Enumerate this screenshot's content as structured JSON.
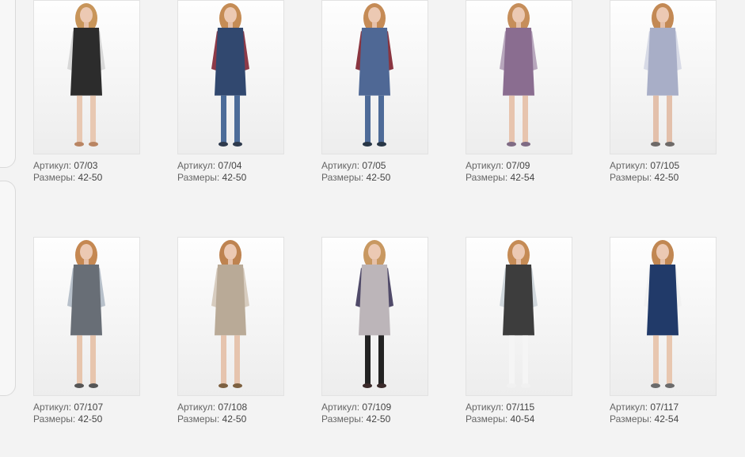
{
  "products": [
    {
      "article_label": "Артикул:",
      "article": "07/03",
      "sizes_label": "Размеры:",
      "sizes": "42-50",
      "dress": "#2c2c2c",
      "accent": "#d8d8d8",
      "hair": "#c8955a",
      "legs": "#e8c8b2",
      "shoes": "#b98563",
      "image_icon": "model-photo-icon"
    },
    {
      "article_label": "Артикул:",
      "article": "07/04",
      "sizes_label": "Размеры:",
      "sizes": "42-50",
      "dress": "#31486f",
      "accent": "#8d3a48",
      "hair": "#c58c55",
      "legs": "#4c6c99",
      "shoes": "#2e3a4d",
      "image_icon": "model-photo-icon"
    },
    {
      "article_label": "Артикул:",
      "article": "07/05",
      "sizes_label": "Размеры:",
      "sizes": "42-50",
      "dress": "#4f6895",
      "accent": "#8a3540",
      "hair": "#c58b56",
      "legs": "#4e6b98",
      "shoes": "#283646",
      "image_icon": "model-photo-icon"
    },
    {
      "article_label": "Артикул:",
      "article": "07/09",
      "sizes_label": "Размеры:",
      "sizes": "42-54",
      "dress": "#8a6d90",
      "accent": "#b7a6bc",
      "hair": "#c68e5a",
      "legs": "#e7c4ae",
      "shoes": "#7f6b84",
      "image_icon": "model-photo-icon"
    },
    {
      "article_label": "Артикул:",
      "article": "07/105",
      "sizes_label": "Размеры:",
      "sizes": "42-50",
      "dress": "#a8aec7",
      "accent": "#d7dae6",
      "hair": "#c38954",
      "legs": "#e3c0ab",
      "shoes": "#6e6a68",
      "image_icon": "model-photo-icon"
    },
    {
      "article_label": "Артикул:",
      "article": "07/107",
      "sizes_label": "Размеры:",
      "sizes": "42-50",
      "dress": "#686e76",
      "accent": "#b7c0ca",
      "hair": "#c58852",
      "legs": "#e7c5ad",
      "shoes": "#555",
      "image_icon": "model-photo-icon"
    },
    {
      "article_label": "Артикул:",
      "article": "07/108",
      "sizes_label": "Размеры:",
      "sizes": "42-50",
      "dress": "#b9aa97",
      "accent": "#d7ccbf",
      "hair": "#be8350",
      "legs": "#e6c4ae",
      "shoes": "#7d6040",
      "image_icon": "model-photo-icon"
    },
    {
      "article_label": "Артикул:",
      "article": "07/109",
      "sizes_label": "Размеры:",
      "sizes": "42-50",
      "dress": "#bcb5b9",
      "accent": "#504a69",
      "hair": "#c89861",
      "legs": "#232323",
      "shoes": "#3a2a2a",
      "image_icon": "model-photo-icon"
    },
    {
      "article_label": "Артикул:",
      "article": "07/115",
      "sizes_label": "Размеры:",
      "sizes": "40-54",
      "dress": "#3d3d3d",
      "accent": "#d0d7dc",
      "hair": "#c58b55",
      "legs": "#f5f5f5",
      "shoes": "#f1f1f1",
      "image_icon": "model-photo-icon"
    },
    {
      "article_label": "Артикул:",
      "article": "07/117",
      "sizes_label": "Размеры:",
      "sizes": "42-54",
      "dress": "#213a69",
      "accent": "#f2f2f2",
      "hair": "#c18752",
      "legs": "#e8c7b0",
      "shoes": "#6b6b6b",
      "image_icon": "model-photo-icon"
    }
  ]
}
